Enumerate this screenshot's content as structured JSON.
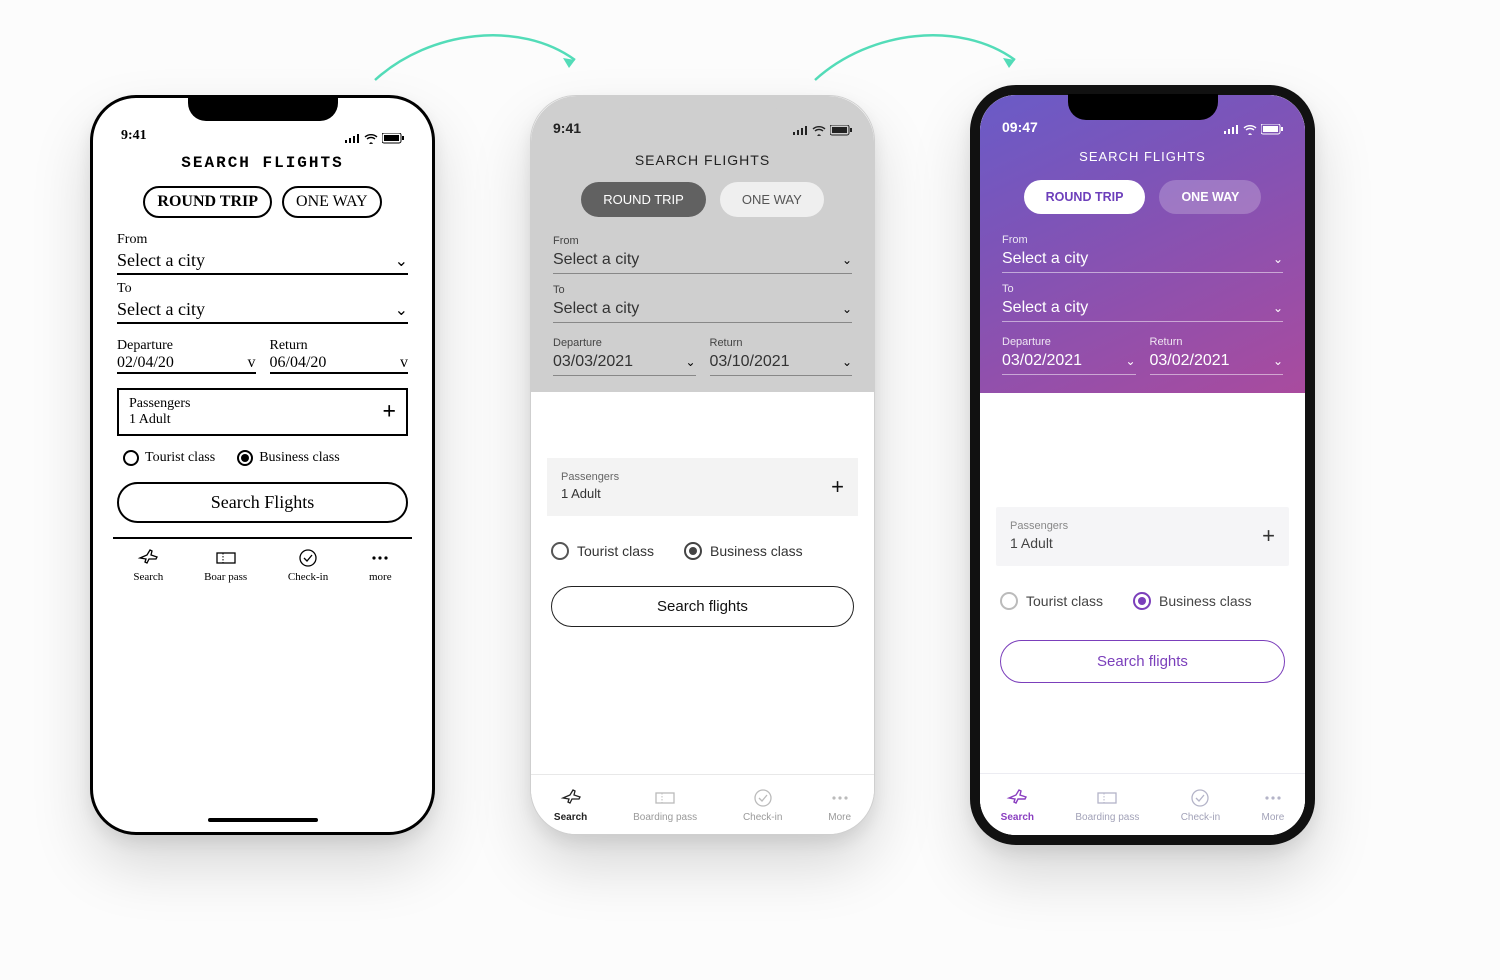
{
  "arrowColor": "#53dcb8",
  "phoneA": {
    "status_time": "9:41",
    "title": "SEARCH  FLIGHTS",
    "toggle": {
      "roundTrip": "ROUND TRIP",
      "oneWay": "ONE WAY",
      "selected": "roundTrip"
    },
    "from": {
      "label": "From",
      "value": "Select a city"
    },
    "to": {
      "label": "To",
      "value": "Select a city"
    },
    "departure": {
      "label": "Departure",
      "value": "02/04/20"
    },
    "return": {
      "label": "Return",
      "value": "06/04/20"
    },
    "passengers": {
      "label": "Passengers",
      "value": "1 Adult"
    },
    "class": {
      "tourist": "Tourist class",
      "business": "Business class",
      "selected": "business"
    },
    "searchBtn": "Search  Flights",
    "tabs": {
      "search": "Search",
      "boarding": "Boar pass",
      "checkin": "Check-in",
      "more": "more"
    }
  },
  "phoneB": {
    "status_time": "9:41",
    "title": "SEARCH FLIGHTS",
    "toggle": {
      "roundTrip": "ROUND TRIP",
      "oneWay": "ONE WAY",
      "selected": "roundTrip"
    },
    "from": {
      "label": "From",
      "value": "Select a city"
    },
    "to": {
      "label": "To",
      "value": "Select a city"
    },
    "departure": {
      "label": "Departure",
      "value": "03/03/2021"
    },
    "return": {
      "label": "Return",
      "value": "03/10/2021"
    },
    "passengers": {
      "label": "Passengers",
      "value": "1 Adult"
    },
    "class": {
      "tourist": "Tourist class",
      "business": "Business class",
      "selected": "business"
    },
    "searchBtn": "Search flights",
    "tabs": {
      "search": "Search",
      "boarding": "Boarding pass",
      "checkin": "Check-in",
      "more": "More"
    }
  },
  "phoneC": {
    "status_time": "09:47",
    "title": "SEARCH FLIGHTS",
    "toggle": {
      "roundTrip": "ROUND TRIP",
      "oneWay": "ONE WAY",
      "selected": "roundTrip"
    },
    "from": {
      "label": "From",
      "value": "Select a city"
    },
    "to": {
      "label": "To",
      "value": "Select a city"
    },
    "departure": {
      "label": "Departure",
      "value": "03/02/2021"
    },
    "return": {
      "label": "Return",
      "value": "03/02/2021"
    },
    "passengers": {
      "label": "Passengers",
      "value": "1 Adult"
    },
    "class": {
      "tourist": "Tourist class",
      "business": "Business class",
      "selected": "business"
    },
    "searchBtn": "Search flights",
    "tabs": {
      "search": "Search",
      "boarding": "Boarding pass",
      "checkin": "Check-in",
      "more": "More"
    },
    "accentColor": "#7b3fbb"
  }
}
